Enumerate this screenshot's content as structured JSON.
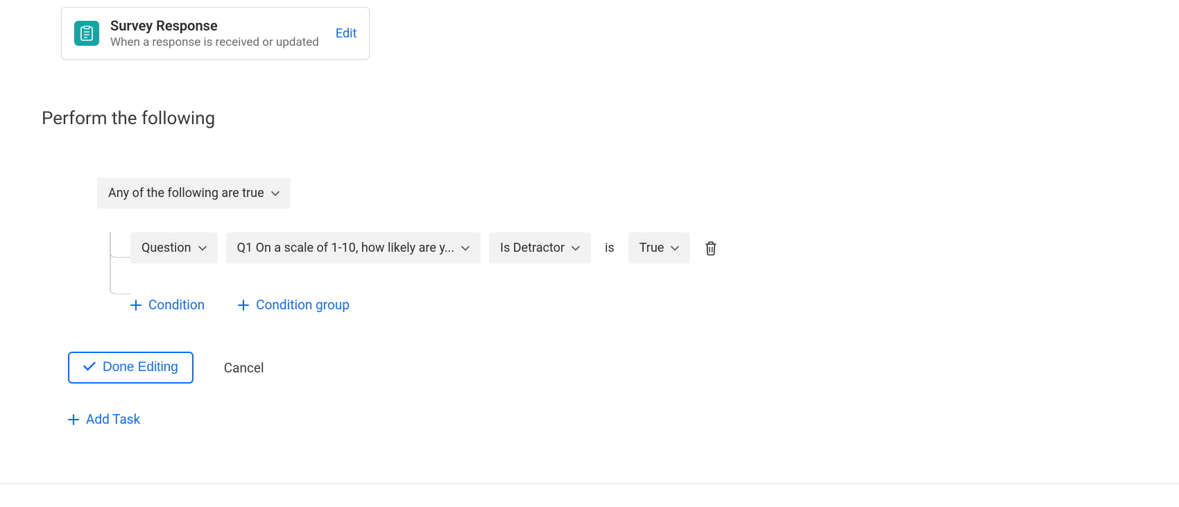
{
  "trigger": {
    "title": "Survey Response",
    "subtitle": "When a response is received or updated",
    "edit_label": "Edit"
  },
  "section_heading": "Perform the following",
  "condition_group": {
    "operator_label": "Any of the following are true",
    "rows": [
      {
        "field_type": "Question",
        "question_text": "Q1 On a scale of 1-10, how likely are y...",
        "property": "Is Detractor",
        "comparator": "is",
        "value": "True"
      }
    ]
  },
  "add_buttons": {
    "condition": "Condition",
    "condition_group": "Condition group"
  },
  "actions": {
    "done": "Done Editing",
    "cancel": "Cancel",
    "add_task": "Add Task"
  }
}
